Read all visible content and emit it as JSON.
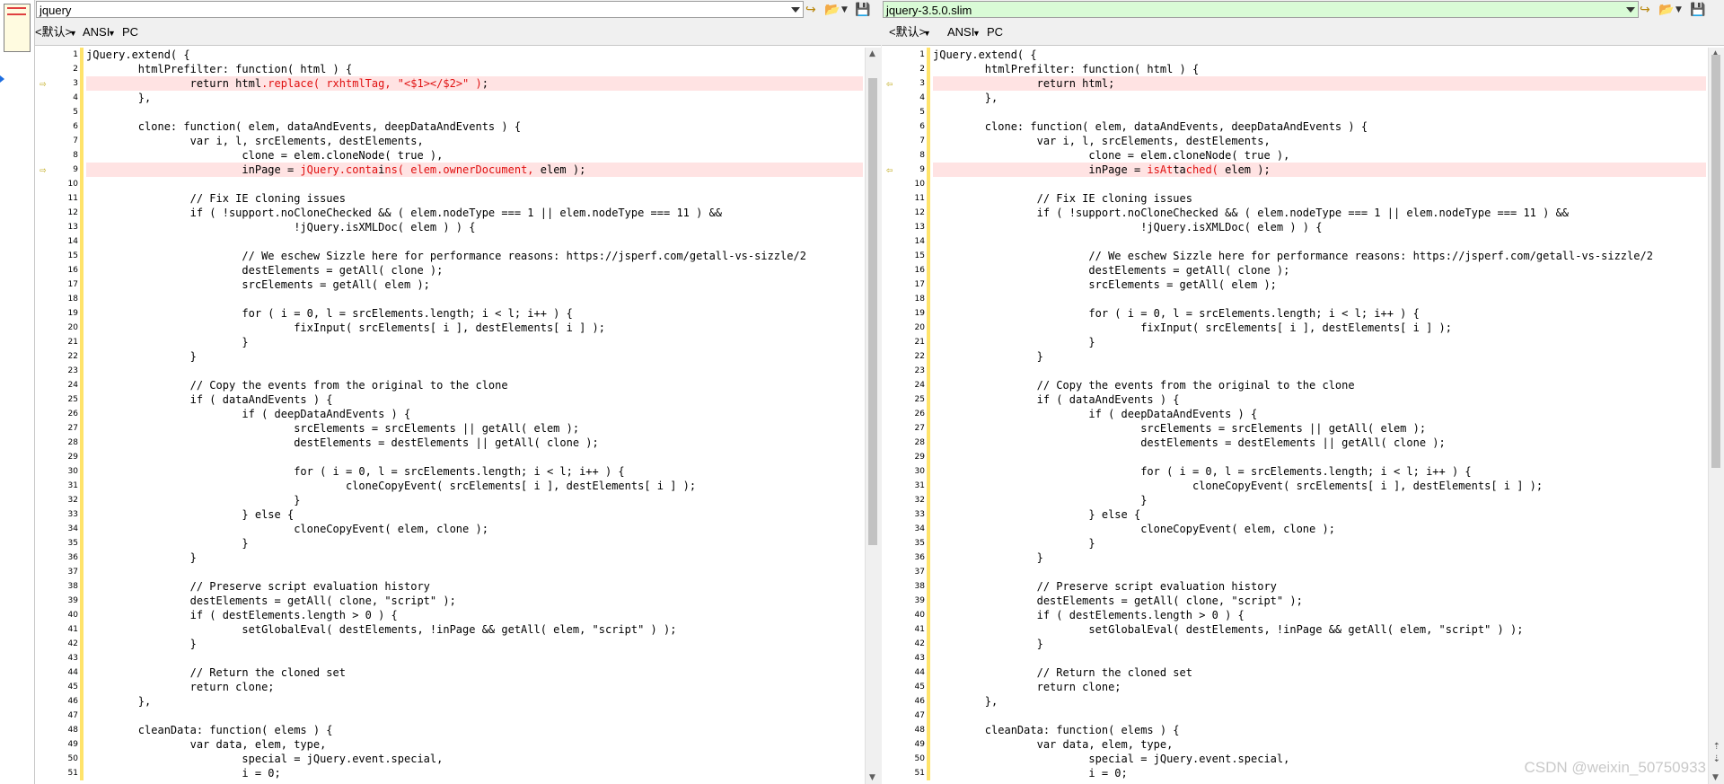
{
  "left": {
    "path": "jquery",
    "encoding_default": "<默认>",
    "encoding": "ANSI",
    "line_ending": "PC",
    "lines": [
      {
        "n": "1",
        "t": "jQuery.extend( {"
      },
      {
        "n": "2",
        "t": "\thtmlPrefilter: function( html ) {"
      },
      {
        "n": "3",
        "diff": true,
        "segs": [
          {
            "t": "\t\treturn html"
          },
          {
            "t": ".replace( rxhtmlTag, \"<$1></$2>\" )",
            "h": true
          },
          {
            "t": ";"
          }
        ]
      },
      {
        "n": "4",
        "t": "\t},"
      },
      {
        "n": "5",
        "t": ""
      },
      {
        "n": "6",
        "t": "\tclone: function( elem, dataAndEvents, deepDataAndEvents ) {"
      },
      {
        "n": "7",
        "t": "\t\tvar i, l, srcElements, destElements,"
      },
      {
        "n": "8",
        "t": "\t\t\tclone = elem.cloneNode( true ),"
      },
      {
        "n": "9",
        "diff": true,
        "segs": [
          {
            "t": "\t\t\tinPage = "
          },
          {
            "t": "jQuery.conta",
            "h": true
          },
          {
            "t": "i"
          },
          {
            "t": "ns( elem.ownerDocument,",
            "h": true
          },
          {
            "t": " elem );"
          }
        ]
      },
      {
        "n": "10",
        "t": ""
      },
      {
        "n": "11",
        "t": "\t\t// Fix IE cloning issues"
      },
      {
        "n": "12",
        "t": "\t\tif ( !support.noCloneChecked && ( elem.nodeType === 1 || elem.nodeType === 11 ) &&"
      },
      {
        "n": "13",
        "t": "\t\t\t\t!jQuery.isXMLDoc( elem ) ) {"
      },
      {
        "n": "14",
        "t": ""
      },
      {
        "n": "15",
        "t": "\t\t\t// We eschew Sizzle here for performance reasons: https://jsperf.com/getall-vs-sizzle/2"
      },
      {
        "n": "16",
        "t": "\t\t\tdestElements = getAll( clone );"
      },
      {
        "n": "17",
        "t": "\t\t\tsrcElements = getAll( elem );"
      },
      {
        "n": "18",
        "t": ""
      },
      {
        "n": "19",
        "t": "\t\t\tfor ( i = 0, l = srcElements.length; i < l; i++ ) {"
      },
      {
        "n": "20",
        "t": "\t\t\t\tfixInput( srcElements[ i ], destElements[ i ] );"
      },
      {
        "n": "21",
        "t": "\t\t\t}"
      },
      {
        "n": "22",
        "t": "\t\t}"
      },
      {
        "n": "23",
        "t": ""
      },
      {
        "n": "24",
        "t": "\t\t// Copy the events from the original to the clone"
      },
      {
        "n": "25",
        "t": "\t\tif ( dataAndEvents ) {"
      },
      {
        "n": "26",
        "t": "\t\t\tif ( deepDataAndEvents ) {"
      },
      {
        "n": "27",
        "t": "\t\t\t\tsrcElements = srcElements || getAll( elem );"
      },
      {
        "n": "28",
        "t": "\t\t\t\tdestElements = destElements || getAll( clone );"
      },
      {
        "n": "29",
        "t": ""
      },
      {
        "n": "30",
        "t": "\t\t\t\tfor ( i = 0, l = srcElements.length; i < l; i++ ) {"
      },
      {
        "n": "31",
        "t": "\t\t\t\t\tcloneCopyEvent( srcElements[ i ], destElements[ i ] );"
      },
      {
        "n": "32",
        "t": "\t\t\t\t}"
      },
      {
        "n": "33",
        "t": "\t\t\t} else {"
      },
      {
        "n": "34",
        "t": "\t\t\t\tcloneCopyEvent( elem, clone );"
      },
      {
        "n": "35",
        "t": "\t\t\t}"
      },
      {
        "n": "36",
        "t": "\t\t}"
      },
      {
        "n": "37",
        "t": ""
      },
      {
        "n": "38",
        "t": "\t\t// Preserve script evaluation history"
      },
      {
        "n": "39",
        "t": "\t\tdestElements = getAll( clone, \"script\" );"
      },
      {
        "n": "40",
        "t": "\t\tif ( destElements.length > 0 ) {"
      },
      {
        "n": "41",
        "t": "\t\t\tsetGlobalEval( destElements, !inPage && getAll( elem, \"script\" ) );"
      },
      {
        "n": "42",
        "t": "\t\t}"
      },
      {
        "n": "43",
        "t": ""
      },
      {
        "n": "44",
        "t": "\t\t// Return the cloned set"
      },
      {
        "n": "45",
        "t": "\t\treturn clone;"
      },
      {
        "n": "46",
        "t": "\t},"
      },
      {
        "n": "47",
        "t": ""
      },
      {
        "n": "48",
        "t": "\tcleanData: function( elems ) {"
      },
      {
        "n": "49",
        "t": "\t\tvar data, elem, type,"
      },
      {
        "n": "50",
        "t": "\t\t\tspecial = jQuery.event.special,"
      },
      {
        "n": "51",
        "t": "\t\t\ti = 0;"
      }
    ]
  },
  "right": {
    "path": "jquery-3.5.0.slim",
    "encoding_default": "<默认>",
    "encoding": "ANSI",
    "line_ending": "PC",
    "lines": [
      {
        "n": "1",
        "t": "jQuery.extend( {"
      },
      {
        "n": "2",
        "t": "\thtmlPrefilter: function( html ) {"
      },
      {
        "n": "3",
        "diff": true,
        "segs": [
          {
            "t": "\t\treturn html;"
          }
        ]
      },
      {
        "n": "4",
        "t": "\t},"
      },
      {
        "n": "5",
        "t": ""
      },
      {
        "n": "6",
        "t": "\tclone: function( elem, dataAndEvents, deepDataAndEvents ) {"
      },
      {
        "n": "7",
        "t": "\t\tvar i, l, srcElements, destElements,"
      },
      {
        "n": "8",
        "t": "\t\t\tclone = elem.cloneNode( true ),"
      },
      {
        "n": "9",
        "diff": true,
        "segs": [
          {
            "t": "\t\t\tinPage = "
          },
          {
            "t": "isAt",
            "h": true
          },
          {
            "t": "ta"
          },
          {
            "t": "ched(",
            "h": true
          },
          {
            "t": " elem );"
          }
        ]
      },
      {
        "n": "10",
        "t": ""
      },
      {
        "n": "11",
        "t": "\t\t// Fix IE cloning issues"
      },
      {
        "n": "12",
        "t": "\t\tif ( !support.noCloneChecked && ( elem.nodeType === 1 || elem.nodeType === 11 ) &&"
      },
      {
        "n": "13",
        "t": "\t\t\t\t!jQuery.isXMLDoc( elem ) ) {"
      },
      {
        "n": "14",
        "t": ""
      },
      {
        "n": "15",
        "t": "\t\t\t// We eschew Sizzle here for performance reasons: https://jsperf.com/getall-vs-sizzle/2"
      },
      {
        "n": "16",
        "t": "\t\t\tdestElements = getAll( clone );"
      },
      {
        "n": "17",
        "t": "\t\t\tsrcElements = getAll( elem );"
      },
      {
        "n": "18",
        "t": ""
      },
      {
        "n": "19",
        "t": "\t\t\tfor ( i = 0, l = srcElements.length; i < l; i++ ) {"
      },
      {
        "n": "20",
        "t": "\t\t\t\tfixInput( srcElements[ i ], destElements[ i ] );"
      },
      {
        "n": "21",
        "t": "\t\t\t}"
      },
      {
        "n": "22",
        "t": "\t\t}"
      },
      {
        "n": "23",
        "t": ""
      },
      {
        "n": "24",
        "t": "\t\t// Copy the events from the original to the clone"
      },
      {
        "n": "25",
        "t": "\t\tif ( dataAndEvents ) {"
      },
      {
        "n": "26",
        "t": "\t\t\tif ( deepDataAndEvents ) {"
      },
      {
        "n": "27",
        "t": "\t\t\t\tsrcElements = srcElements || getAll( elem );"
      },
      {
        "n": "28",
        "t": "\t\t\t\tdestElements = destElements || getAll( clone );"
      },
      {
        "n": "29",
        "t": ""
      },
      {
        "n": "30",
        "t": "\t\t\t\tfor ( i = 0, l = srcElements.length; i < l; i++ ) {"
      },
      {
        "n": "31",
        "t": "\t\t\t\t\tcloneCopyEvent( srcElements[ i ], destElements[ i ] );"
      },
      {
        "n": "32",
        "t": "\t\t\t\t}"
      },
      {
        "n": "33",
        "t": "\t\t\t} else {"
      },
      {
        "n": "34",
        "t": "\t\t\t\tcloneCopyEvent( elem, clone );"
      },
      {
        "n": "35",
        "t": "\t\t\t}"
      },
      {
        "n": "36",
        "t": "\t\t}"
      },
      {
        "n": "37",
        "t": ""
      },
      {
        "n": "38",
        "t": "\t\t// Preserve script evaluation history"
      },
      {
        "n": "39",
        "t": "\t\tdestElements = getAll( clone, \"script\" );"
      },
      {
        "n": "40",
        "t": "\t\tif ( destElements.length > 0 ) {"
      },
      {
        "n": "41",
        "t": "\t\t\tsetGlobalEval( destElements, !inPage && getAll( elem, \"script\" ) );"
      },
      {
        "n": "42",
        "t": "\t\t}"
      },
      {
        "n": "43",
        "t": ""
      },
      {
        "n": "44",
        "t": "\t\t// Return the cloned set"
      },
      {
        "n": "45",
        "t": "\t\treturn clone;"
      },
      {
        "n": "46",
        "t": "\t},"
      },
      {
        "n": "47",
        "t": ""
      },
      {
        "n": "48",
        "t": "\tcleanData: function( elems ) {"
      },
      {
        "n": "49",
        "t": "\t\tvar data, elem, type,"
      },
      {
        "n": "50",
        "t": "\t\t\tspecial = jQuery.event.special,"
      },
      {
        "n": "51",
        "t": "\t\t\ti = 0;"
      }
    ]
  },
  "icons": {
    "left_diff_arrow": "right-arrow-icon",
    "right_diff_arrow": "left-arrow-icon",
    "open_folder": "folder-open-icon",
    "save": "save-icon",
    "go_to_diff": "go-to-diff-icon"
  },
  "colors": {
    "diff_line_bg": "#ffe3e3",
    "diff_text": "#e01010",
    "changed_marker": "#ffe36a",
    "right_path_bg": "#d9fbd6"
  },
  "watermark": "CSDN @weixin_50750933"
}
